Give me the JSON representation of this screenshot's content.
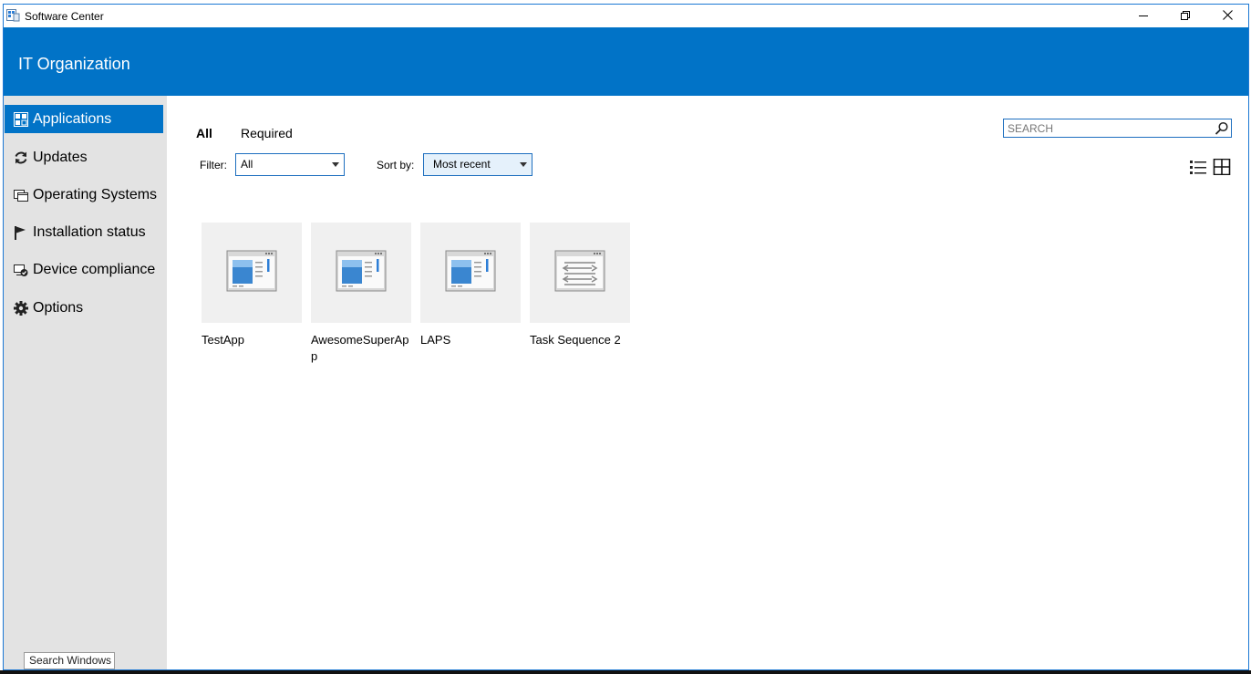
{
  "window": {
    "title": "Software Center",
    "app_icon": "software-center-icon",
    "caption_buttons": [
      "minimize-icon",
      "restore-icon",
      "close-icon"
    ]
  },
  "header": {
    "org_name": "IT Organization",
    "color": "#0173c7"
  },
  "sidebar": {
    "items": [
      {
        "label": "Applications",
        "icon": "applications-icon",
        "active": true
      },
      {
        "label": "Updates",
        "icon": "refresh-icon"
      },
      {
        "label": "Operating Systems",
        "icon": "windows-stack-icon"
      },
      {
        "label": "Installation status",
        "icon": "flag-icon"
      },
      {
        "label": "Device compliance",
        "icon": "device-compliance-icon"
      },
      {
        "label": "Options",
        "icon": "gear-icon"
      }
    ],
    "search_windows": "Search Windows"
  },
  "main": {
    "tabs": [
      {
        "label": "All",
        "active": true
      },
      {
        "label": "Required"
      }
    ],
    "filter": {
      "label": "Filter:",
      "value": "All"
    },
    "sort": {
      "label": "Sort by:",
      "value": "Most recent"
    },
    "search": {
      "placeholder": "SEARCH"
    },
    "view_buttons": [
      "list-view-icon",
      "tile-view-icon"
    ],
    "apps": [
      {
        "name": "TestApp",
        "icon": "application-window-icon"
      },
      {
        "name": "AwesomeSuperApp",
        "icon": "application-window-icon"
      },
      {
        "name": "LAPS",
        "icon": "application-window-icon"
      },
      {
        "name": "Task Sequence 2",
        "icon": "task-sequence-icon"
      }
    ]
  },
  "colors": {
    "accent": "#0173c7",
    "sidebar_bg": "#e3e3e3",
    "tile_bg": "#f0f0f0"
  }
}
